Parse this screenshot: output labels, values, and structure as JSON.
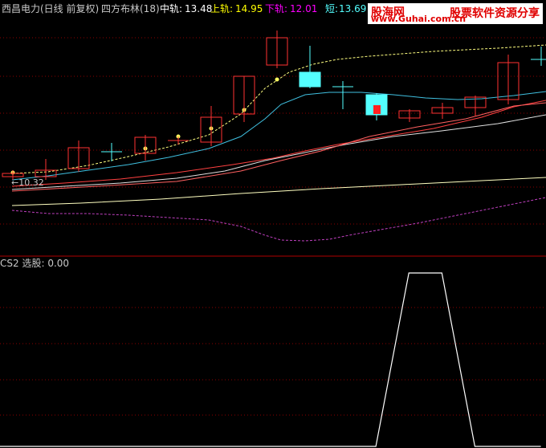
{
  "header": {
    "stock_name": "西昌电力",
    "period": "(日线 前复权)",
    "indicator": "四方布林(18)",
    "mid_label": "中轨:",
    "mid_value": "13.48",
    "upper_label": "上轨:",
    "upper_value": "14.95",
    "lower_label": "下轨:",
    "lower_value": "12.01",
    "short_label": "短:",
    "short_value": "13.69"
  },
  "watermark": {
    "site_name": "股海网",
    "url": "www.Guhai.com.cn",
    "slogan": "股票软件资源分享"
  },
  "main_chart": {
    "low_marker": "←10.32"
  },
  "sub_chart": {
    "title": "CS2 选股:",
    "value": "0.00"
  },
  "colors": {
    "background": "#000000",
    "rise": "#ff3232",
    "fall": "#54ffff",
    "mid": "#ffffff",
    "upper": "#ffff00",
    "lower": "#ff00ff",
    "short": "#ffff00",
    "grid": "#8b0000"
  },
  "chart_data": {
    "type": "candlestick",
    "indicator_lines": [
      "中轨",
      "上轨",
      "下轨",
      "短"
    ],
    "sub_series": {
      "name": "CS2 选股",
      "values": [
        0,
        0,
        0,
        0,
        0,
        0,
        0,
        0,
        0,
        0,
        0,
        0,
        1,
        1,
        0,
        0,
        0,
        0,
        0,
        0,
        0,
        0,
        0,
        0,
        0,
        0,
        0,
        0
      ]
    }
  }
}
